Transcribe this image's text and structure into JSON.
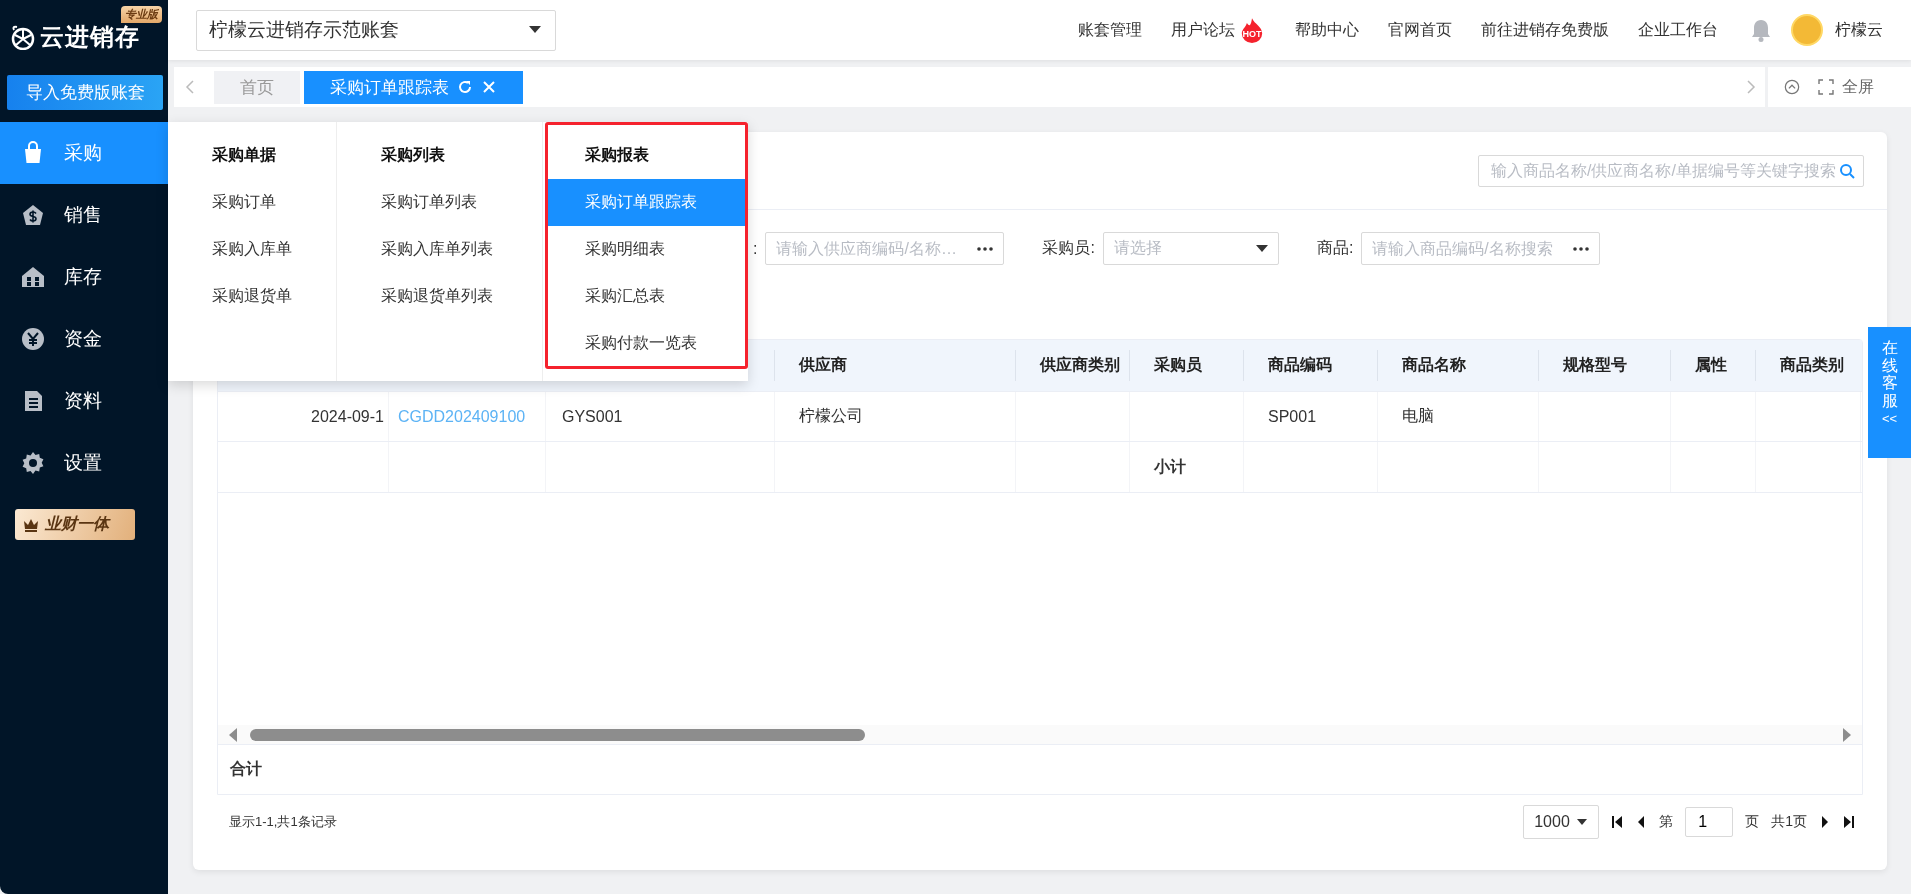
{
  "sidebar": {
    "logo": "云进销存",
    "edition_badge": "专业版",
    "import_button": "导入免费版账套",
    "items": [
      {
        "label": "采购",
        "selected": true
      },
      {
        "label": "销售",
        "selected": false
      },
      {
        "label": "库存",
        "selected": false
      },
      {
        "label": "资金",
        "selected": false
      },
      {
        "label": "资料",
        "selected": false
      },
      {
        "label": "设置",
        "selected": false
      }
    ],
    "promo_badge": "业财一体"
  },
  "topbar": {
    "account_select": "柠檬云进销存示范账套",
    "links": [
      {
        "label": "账套管理"
      },
      {
        "label": "用户论坛",
        "hot_badge": "HOT"
      },
      {
        "label": "帮助中心"
      },
      {
        "label": "官网首页"
      },
      {
        "label": "前往进销存免费版"
      },
      {
        "label": "企业工作台"
      }
    ],
    "user_name": "柠檬云"
  },
  "tabs": [
    {
      "label": "首页",
      "selected": false
    },
    {
      "label": "采购订单跟踪表",
      "selected": true
    }
  ],
  "fullscreen_label": "全屏",
  "mega_menu": {
    "columns": [
      {
        "title": "采购单据",
        "highlighted": false,
        "items": [
          {
            "label": "采购订单",
            "selected": false
          },
          {
            "label": "采购入库单",
            "selected": false
          },
          {
            "label": "采购退货单",
            "selected": false
          }
        ]
      },
      {
        "title": "采购列表",
        "highlighted": false,
        "items": [
          {
            "label": "采购订单列表",
            "selected": false
          },
          {
            "label": "采购入库单列表",
            "selected": false
          },
          {
            "label": "采购退货单列表",
            "selected": false
          }
        ]
      },
      {
        "title": "采购报表",
        "highlighted": true,
        "items": [
          {
            "label": "采购订单跟踪表",
            "selected": true
          },
          {
            "label": "采购明细表",
            "selected": false
          },
          {
            "label": "采购汇总表",
            "selected": false
          },
          {
            "label": "采购付款一览表",
            "selected": false
          }
        ]
      }
    ]
  },
  "search": {
    "placeholder": "输入商品名称/供应商名称/单据编号等关键字搜索"
  },
  "filters": [
    {
      "kind": "picker",
      "label": ":",
      "placeholder": "请输入供应商编码/名称…"
    },
    {
      "kind": "select",
      "label": "采购员:",
      "placeholder": "请选择"
    },
    {
      "kind": "picker",
      "label": "商品:",
      "placeholder": "请输入商品编码/名称搜索"
    }
  ],
  "table": {
    "columns": [
      {},
      {},
      {},
      {
        "label": "供应商"
      },
      {
        "label": "供应商类别"
      },
      {
        "label": "采购员"
      },
      {
        "label": "商品编码"
      },
      {
        "label": "商品名称"
      },
      {
        "label": "规格型号"
      },
      {
        "label": "属性"
      },
      {
        "label": "商品类别"
      }
    ],
    "rows": [
      {
        "kind": "data",
        "cells": [
          {
            "text": "2024-09-1",
            "link": false
          },
          {
            "text": "CGDD202409100",
            "link": true
          },
          {
            "text": "GYS001",
            "link": false
          },
          {
            "text": "柠檬公司",
            "link": false
          },
          {},
          {},
          {
            "text": "SP001",
            "link": false
          },
          {
            "text": "电脑",
            "link": false
          },
          {},
          {},
          {}
        ]
      },
      {
        "kind": "subtotal",
        "cells": [
          {},
          {},
          {},
          {},
          {},
          {
            "text": "小计",
            "link": false
          },
          {},
          {},
          {},
          {},
          {}
        ]
      }
    ],
    "total_label": "合计"
  },
  "footer": {
    "record_info": "显示1-1,共1条记录",
    "page_size": "1000",
    "page_prefix": "第",
    "page_input": "1",
    "page_suffix": "页",
    "page_total": "共1页"
  },
  "online_service": {
    "label": "在线客服",
    "toggle": "<<"
  }
}
